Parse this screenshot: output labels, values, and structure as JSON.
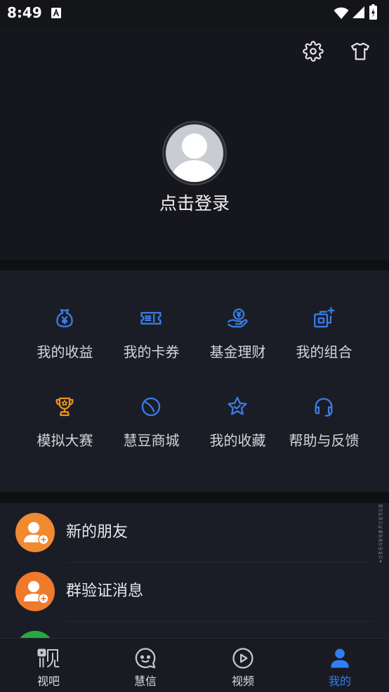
{
  "status_bar": {
    "time": "8:49",
    "icons": [
      "app-notification-icon",
      "wifi-icon",
      "signal-icon",
      "battery-charging-icon"
    ]
  },
  "header": {
    "login_label": "点击登录",
    "actions": [
      {
        "icon": "settings-gear-icon"
      },
      {
        "icon": "tshirt-skin-icon"
      }
    ],
    "avatar_icon": "default-avatar-icon"
  },
  "grid": {
    "items": [
      {
        "label": "我的收益",
        "icon": "money-bag-icon"
      },
      {
        "label": "我的卡券",
        "icon": "ticket-icon"
      },
      {
        "label": "基金理财",
        "icon": "hand-coin-icon"
      },
      {
        "label": "我的组合",
        "icon": "portfolio-add-icon"
      },
      {
        "label": "模拟大赛",
        "icon": "trophy-icon"
      },
      {
        "label": "慧豆商城",
        "icon": "bean-icon"
      },
      {
        "label": "我的收藏",
        "icon": "star-check-icon"
      },
      {
        "label": "帮助与反馈",
        "icon": "headset-icon"
      }
    ]
  },
  "contacts": {
    "items": [
      {
        "label": "新的朋友",
        "icon": "add-friend-icon"
      },
      {
        "label": "群验证消息",
        "icon": "group-verify-icon"
      }
    ]
  },
  "index_bar": {
    "letters": "ABCDEFGHIJKLMNOPQRSTUVWXYZ#"
  },
  "nav": {
    "items": [
      {
        "label": "视吧",
        "icon": "shiba-logo-icon",
        "active": false
      },
      {
        "label": "慧信",
        "icon": "chat-bubble-icon",
        "active": false
      },
      {
        "label": "视频",
        "icon": "play-circle-icon",
        "active": false
      },
      {
        "label": "我的",
        "icon": "person-icon",
        "active": true
      }
    ]
  },
  "colors": {
    "background": "#16171d",
    "card": "#1b1d26",
    "accent_blue": "#2f7ff5",
    "icon_blue": "#3a7ee6",
    "trophy_orange": "#ec9320",
    "contact_orange": "#f28a30",
    "text": "#e4e4e8"
  }
}
